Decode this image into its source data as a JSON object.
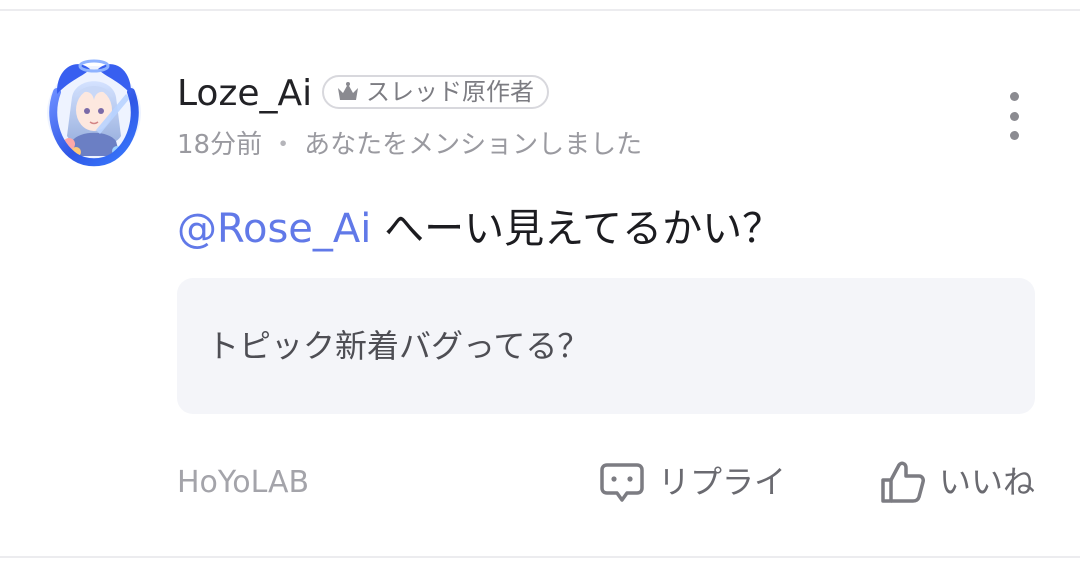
{
  "post": {
    "username": "Loze_Ai",
    "author_badge": "スレッド原作者",
    "time": "18分前",
    "separator": "・",
    "meta_text": "あなたをメンションしました",
    "mention": "@Rose_Ai",
    "message": "へーい見えてるかい？",
    "quote": "トピック新着バグってる？",
    "source": "HoYoLAB"
  },
  "actions": {
    "reply_label": "リプライ",
    "like_label": "いいね"
  },
  "icons": {
    "avatar": "character-avatar-icon",
    "badge": "crown-icon",
    "more": "more-vertical-icon",
    "reply": "speech-bubble-icon",
    "like": "thumbs-up-icon"
  },
  "colors": {
    "mention": "#6179e8",
    "quote_background": "#f4f5f9",
    "secondary_text": "#9a9aa0"
  }
}
